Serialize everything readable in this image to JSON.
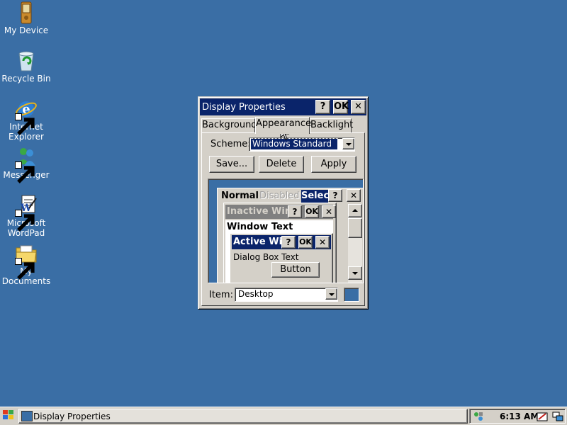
{
  "desktop": {
    "icons": [
      {
        "label": "My Device",
        "icon": "pda-icon"
      },
      {
        "label": "Recycle Bin",
        "icon": "recycle-bin-icon"
      },
      {
        "label_lines": [
          "Internet",
          "Explorer"
        ],
        "icon": "internet-explorer-icon"
      },
      {
        "label": "Messenger",
        "icon": "messenger-icon"
      },
      {
        "label_lines": [
          "Microsoft",
          "WordPad"
        ],
        "icon": "wordpad-icon"
      },
      {
        "label_lines": [
          "My",
          "Documents"
        ],
        "icon": "folder-icon"
      }
    ]
  },
  "dialog": {
    "title": "Display Properties",
    "help_label": "?",
    "ok_label": "OK",
    "close_label": "✕",
    "tabs": [
      {
        "label": "Background",
        "active": false
      },
      {
        "label": "Appearance",
        "active": true
      },
      {
        "label": "Backlight",
        "active": false
      }
    ],
    "scheme_label": "Scheme:",
    "scheme_value": "Windows Standard",
    "buttons": {
      "save": "Save...",
      "delete": "Delete",
      "apply": "Apply"
    },
    "preview": {
      "menu_normal": "Normal",
      "menu_disabled": "Disabled",
      "menu_selected": "Selec",
      "inactive_title": "Inactive Wind",
      "window_text": "Window Text",
      "active_title": "Active Win",
      "dialog_text": "Dialog Box Text",
      "button_label": "Button"
    },
    "item_label": "Item:",
    "item_value": "Desktop",
    "color_swatch": "#3a6ea5"
  },
  "taskbar": {
    "task_label": "Display Properties",
    "clock": "6:13 AM"
  },
  "colors": {
    "desktop": "#3a6ea5",
    "active_title": "#0a246a",
    "inactive_title": "#808080",
    "face": "#d4d0c8"
  }
}
